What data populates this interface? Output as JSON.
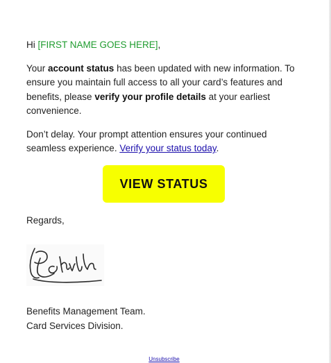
{
  "email": {
    "greeting_prefix": "Hi ",
    "name_placeholder": "[FIRST NAME GOES HERE]",
    "greeting_suffix": ",",
    "para1": {
      "t1": "Your ",
      "b1": "account status",
      "t2": " has been updated with new information. To ensure you maintain full access to all your card’s features and benefits, please ",
      "b2": "verify your profile details",
      "t3": " at your earliest convenience."
    },
    "para2": {
      "t1": "Don’t delay. Your prompt attention ensures your continued seamless experience. ",
      "link": "Verify your status today",
      "t2": "."
    },
    "cta_label": "VIEW STATUS",
    "regards": "Regards,",
    "team_line1": "Benefits Management Team.",
    "team_line2": "Card Services Division.",
    "unsubscribe": "Unsubscribe"
  },
  "colors": {
    "cta_background": "#f7ff00",
    "placeholder_text": "#1f9c2f",
    "link": "#1a0dab"
  }
}
